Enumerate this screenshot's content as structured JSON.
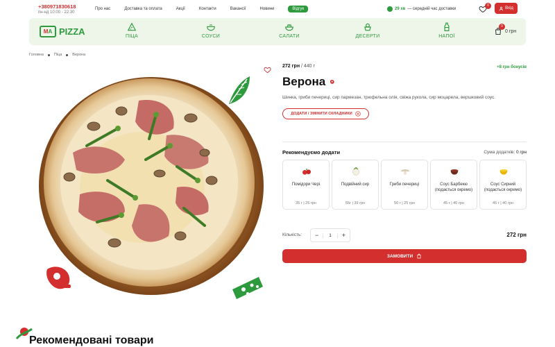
{
  "topbar": {
    "phone": "+380971830618",
    "hours": "пн-нд 10:00 - 22:30",
    "nav": [
      "Про нас",
      "Доставка та оплата",
      "Акції",
      "Контакти",
      "Вакансії",
      "Новини"
    ],
    "feedback_label": "Відгук",
    "delivery_time": "29 хв",
    "delivery_text": "— середній час доставки",
    "wishlist_count": "0",
    "login_label": "Вхід"
  },
  "catbar": {
    "logo_letters": "MA",
    "logo_text": "PIZZA",
    "categories": [
      "ПІЦА",
      "СОУСИ",
      "САЛАТИ",
      "ДЕСЕРТИ",
      "НАПОЇ"
    ],
    "cart_count": "0",
    "cart_total": "0 грн"
  },
  "breadcrumb": [
    "Головна",
    "Піца",
    "Верона"
  ],
  "product": {
    "price": "272 грн",
    "weight": "/ 440 г",
    "bonus": "+8 грн бонусів",
    "title": "Верона",
    "description": "Шинка, гриби печериці, сир пармезан, трюфельна олія, свіжа рукола, сир моцарела, вершковий соус.",
    "change_button": "ДОДАТИ / ЗМІНИТИ СКЛАДНИКИ"
  },
  "addons": {
    "title": "Рекомендуємо додати",
    "sum_label": "Сума додатків:",
    "sum_value": "0 грн",
    "items": [
      {
        "name": "Помідори Чері",
        "meta": "35 г | 25 грн"
      },
      {
        "name": "Подвійний сир",
        "meta": "55г | 39 грн"
      },
      {
        "name": "Гриби печериці",
        "meta": "50 г | 25 грн"
      },
      {
        "name": "Соус Барбекю (подається окремо)",
        "meta": "45 г | 40 грн"
      },
      {
        "name": "Соус Сирний (подається окремо)",
        "meta": "45 г | 40 грн"
      }
    ]
  },
  "quantity": {
    "label": "Кількість:",
    "value": "1",
    "total": "272 грн"
  },
  "order_button": "ЗАМОВИТИ",
  "recommended_title": "Рекомендовані товари",
  "colors": {
    "brand_red": "#d32f2f",
    "brand_green": "#2e9a3e",
    "catbar_bg": "#eef6e9"
  }
}
